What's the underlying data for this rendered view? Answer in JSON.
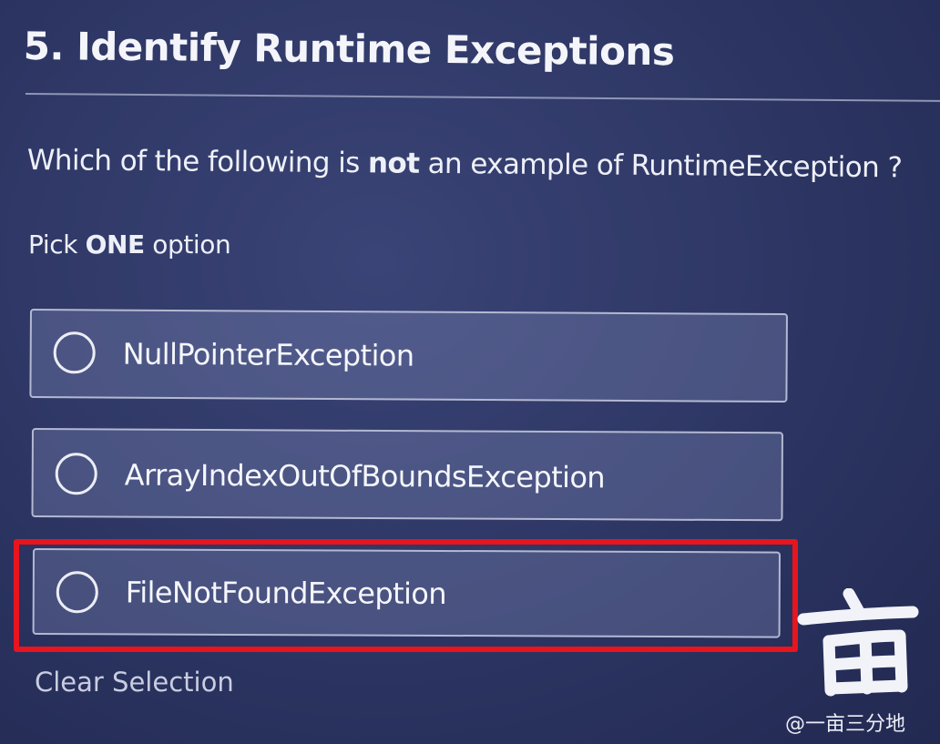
{
  "question": {
    "title": "5. Identify Runtime Exceptions",
    "prompt_before": "Which of the following is ",
    "prompt_emphasis": "not",
    "prompt_after": " an example of RuntimeException ?",
    "instruction_before": "Pick ",
    "instruction_emphasis": "ONE",
    "instruction_after": " option"
  },
  "options": [
    {
      "label": "NullPointerException",
      "selected": false
    },
    {
      "label": "ArrayIndexOutOfBoundsException",
      "selected": false
    },
    {
      "label": "FileNotFoundException",
      "selected": false
    }
  ],
  "highlight": {
    "color": "#e8141e",
    "target_option": "FileNotFoundException"
  },
  "actions": {
    "clear_selection": "Clear Selection"
  },
  "watermark": {
    "logo_char": "亩",
    "text": "@一亩三分地"
  },
  "colors": {
    "background": "#2f3866",
    "option_fill": "#5a6291",
    "option_border": "#b3b9d3",
    "highlight": "#e8141e",
    "text": "#ffffff"
  },
  "icons": {
    "option_marker": "radio-circle-icon"
  }
}
